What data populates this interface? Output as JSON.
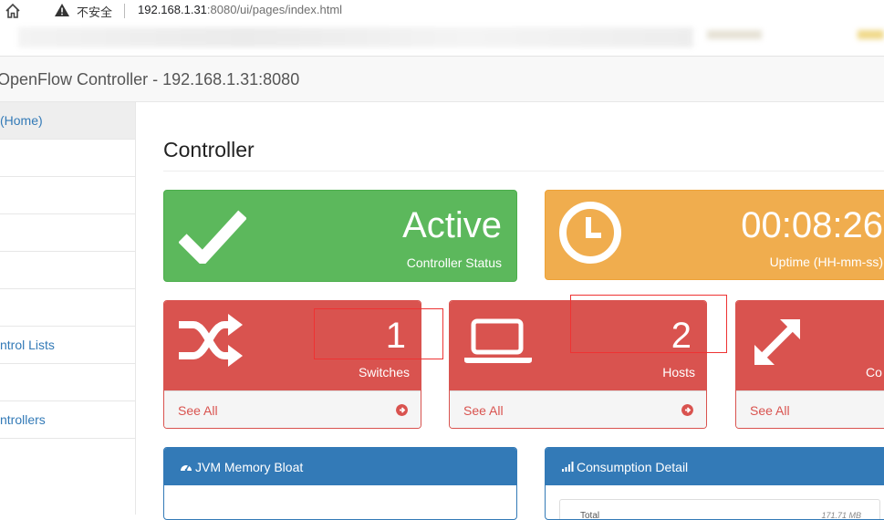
{
  "browser": {
    "security_label": "不安全",
    "url_host": "192.168.1.31",
    "url_rest": ":8080/ui/pages/index.html"
  },
  "navbar": {
    "brand": "OpenFlow Controller - 192.168.1.31:8080"
  },
  "sidebar": {
    "items": [
      {
        "label": "(Home)"
      },
      {
        "label": ""
      },
      {
        "label": ""
      },
      {
        "label": ""
      },
      {
        "label": ""
      },
      {
        "label": ""
      },
      {
        "label": "ntrol Lists"
      },
      {
        "label": ""
      },
      {
        "label": "ntrollers"
      }
    ]
  },
  "main": {
    "title": "Controller",
    "status": {
      "value": "Active",
      "label": "Controller Status"
    },
    "uptime": {
      "value": "00:08:26",
      "label": "Uptime (HH-mm-ss)"
    },
    "switches": {
      "value": "1",
      "label": "Switches",
      "link": "See All"
    },
    "hosts": {
      "value": "2",
      "label": "Hosts",
      "link": "See All"
    },
    "third": {
      "value": "",
      "label": "Co",
      "link": "See All"
    },
    "memory_panel": {
      "title": "JVM Memory Bloat"
    },
    "consumption_panel": {
      "title": "Consumption Detail",
      "row_label": "Total",
      "row_value": "171.71 MB"
    }
  },
  "colors": {
    "green": "#5cb85c",
    "orange": "#f0ad4e",
    "red": "#d9534f",
    "blue": "#337ab7"
  }
}
